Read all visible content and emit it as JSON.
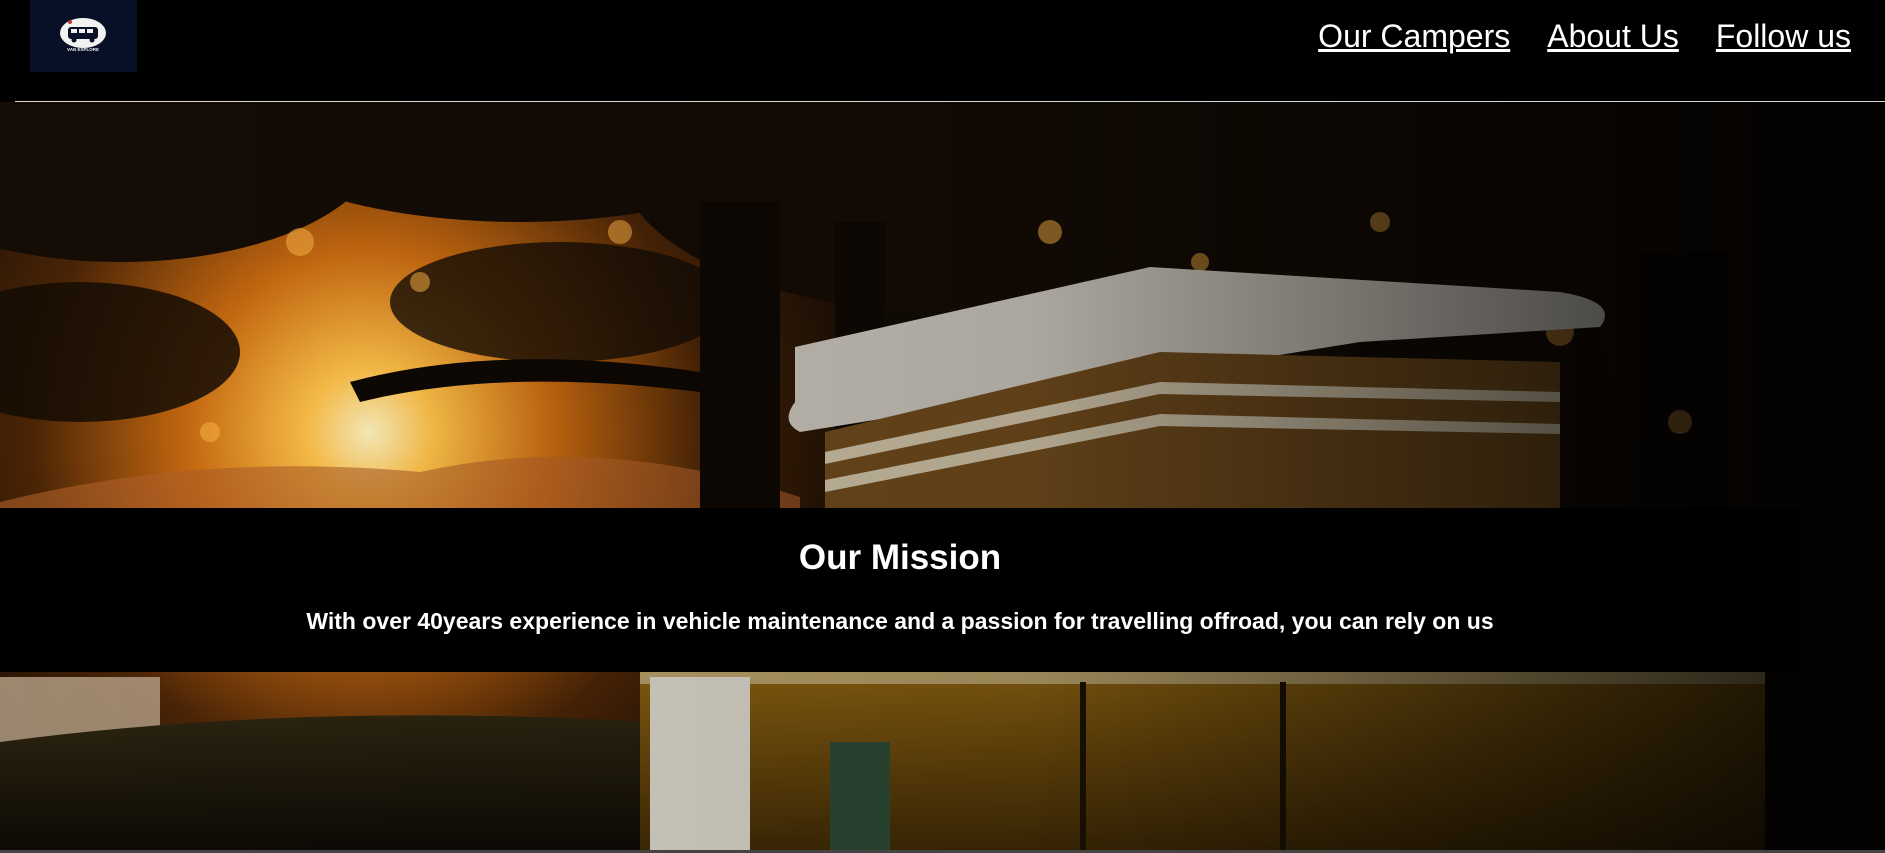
{
  "header": {
    "logo": {
      "icon": "van-logo-icon",
      "text": "VAN EXPLORE",
      "background_color": "#081028"
    },
    "nav": [
      {
        "label": "Our Campers"
      },
      {
        "label": "About Us"
      },
      {
        "label": "Follow us"
      }
    ]
  },
  "hero": {
    "image": "campervan-at-sunset-photo"
  },
  "mission": {
    "title": "Our Mission",
    "text": "With over 40years experience in vehicle maintenance and a passion for travelling offroad, you can rely on us"
  }
}
